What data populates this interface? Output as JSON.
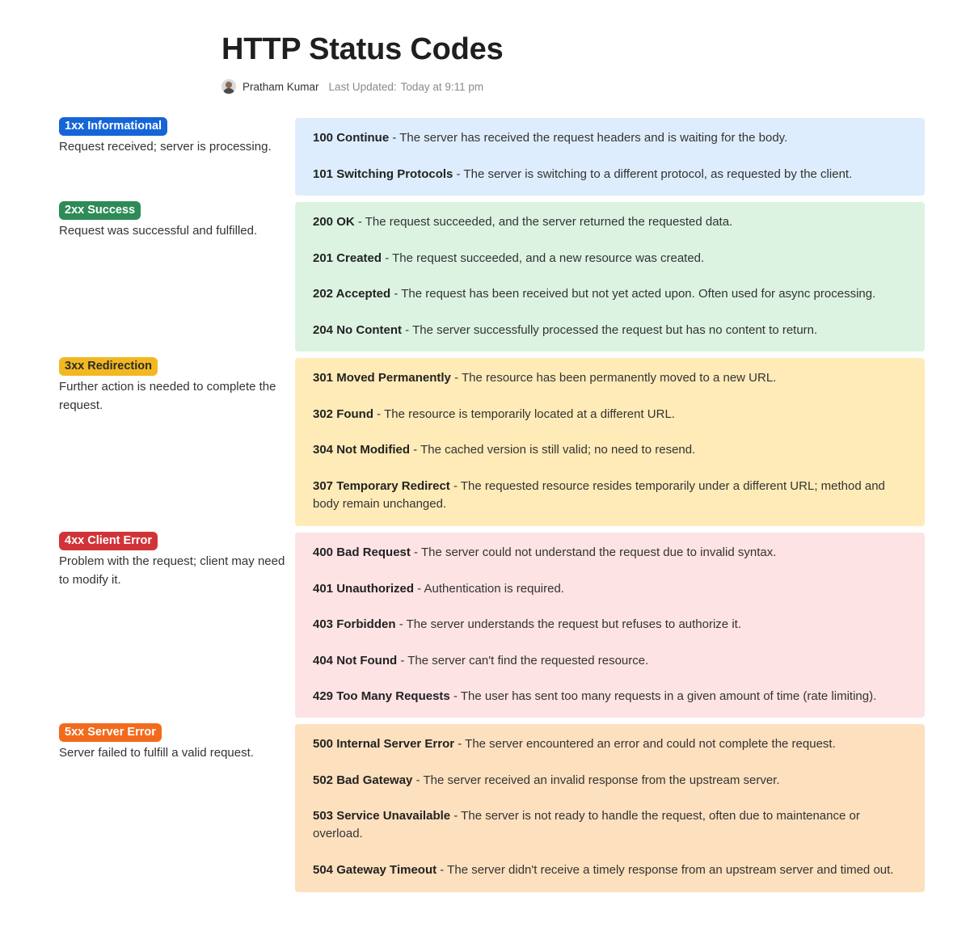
{
  "page": {
    "title": "HTTP Status Codes",
    "author": "Pratham Kumar",
    "last_updated_label": "Last Updated:",
    "last_updated_value": "Today at 9:11 pm"
  },
  "sections": [
    {
      "badge": "1xx Informational",
      "badge_color": "#1565d8",
      "panel_color": "#deedfd",
      "description": "Request received; server is processing.",
      "items": [
        {
          "code": "100 Continue",
          "text": " - The server has received the request headers and is waiting for the body."
        },
        {
          "code": "101 Switching Protocols",
          "text": " - The server is switching to a different protocol, as requested by the client."
        }
      ]
    },
    {
      "badge": "2xx Success",
      "badge_color": "#2e8b57",
      "panel_color": "#dcf3e2",
      "description": "Request was successful and fulfilled.",
      "items": [
        {
          "code": "200 OK",
          "text": " - The request succeeded, and the server returned the requested data."
        },
        {
          "code": "201 Created",
          "text": " - The request succeeded, and a new resource was created."
        },
        {
          "code": "202 Accepted",
          "text": " - The request has been received but not yet acted upon. Often used for async processing."
        },
        {
          "code": "204 No Content",
          "text": " - The server successfully processed the request but has no content to return."
        }
      ]
    },
    {
      "badge": "3xx Redirection",
      "badge_color": "#f2b820",
      "badge_text_color": "#2b2b2b",
      "panel_color": "#feebb7",
      "description": "Further action is needed to complete the request.",
      "items": [
        {
          "code": "301 Moved Permanently",
          "text": " - The resource has been permanently moved to a new URL."
        },
        {
          "code": "302 Found",
          "text": " - The resource is temporarily located at a different URL."
        },
        {
          "code": "304 Not Modified",
          "text": " - The cached version is still valid; no need to resend."
        },
        {
          "code": "307 Temporary Redirect",
          "text": " - The requested resource resides temporarily under a different URL; method and body remain unchanged."
        }
      ]
    },
    {
      "badge": "4xx Client Error",
      "badge_color": "#d13438",
      "panel_color": "#fde3e4",
      "description": "Problem with the request; client may need to modify it.",
      "items": [
        {
          "code": "400 Bad Request",
          "text": " - The server could not understand the request due to invalid syntax."
        },
        {
          "code": "401 Unauthorized",
          "text": " - Authentication is required."
        },
        {
          "code": "403 Forbidden",
          "text": " - The server understands the request but refuses to authorize it."
        },
        {
          "code": "404 Not Found",
          "text": " - The server can't find the requested resource."
        },
        {
          "code": "429 Too Many Requests",
          "text": " - The user has sent too many requests in a given amount of time (rate limiting)."
        }
      ]
    },
    {
      "badge": "5xx Server Error",
      "badge_color": "#f26b1d",
      "panel_color": "#fde0be",
      "description": "Server failed to fulfill a valid request.",
      "items": [
        {
          "code": "500 Internal Server Error",
          "text": " - The server encountered an error and could not complete the request."
        },
        {
          "code": "502 Bad Gateway",
          "text": " - The server received an invalid response from the upstream server."
        },
        {
          "code": "503 Service Unavailable",
          "text": " - The server is not ready to handle the request, often due to maintenance or overload."
        },
        {
          "code": "504 Gateway Timeout",
          "text": " - The server didn't receive a timely response from an upstream server and timed out."
        }
      ]
    }
  ]
}
